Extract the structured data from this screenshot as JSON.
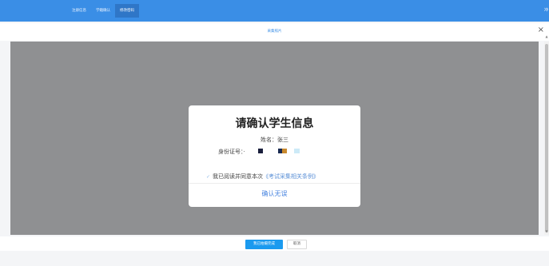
{
  "topbar": {
    "nav": [
      "注册信息",
      "学籍确认",
      "修改密码"
    ],
    "active_index": 2,
    "right_text": "冲"
  },
  "dialog": {
    "title": "采集照片",
    "close_icon": "×"
  },
  "scrollbar": {
    "up_icon": "▲",
    "down_icon": "▼"
  },
  "confirm": {
    "heading": "请确认学生信息",
    "name_label": "姓名：张三",
    "id_label": "身份证号：·",
    "agree_prefix": "我已阅读并同意本次",
    "agree_link": "《考试采集相关条例》",
    "check_icon": "✓",
    "confirm_button": "确认无误",
    "id_block_colors": [
      "#1a1f3c",
      "#1a2b52",
      "#c98a2e",
      "#cdeaf7"
    ]
  },
  "buttons": {
    "done": "我已拍摄完成",
    "cancel": "取消"
  }
}
